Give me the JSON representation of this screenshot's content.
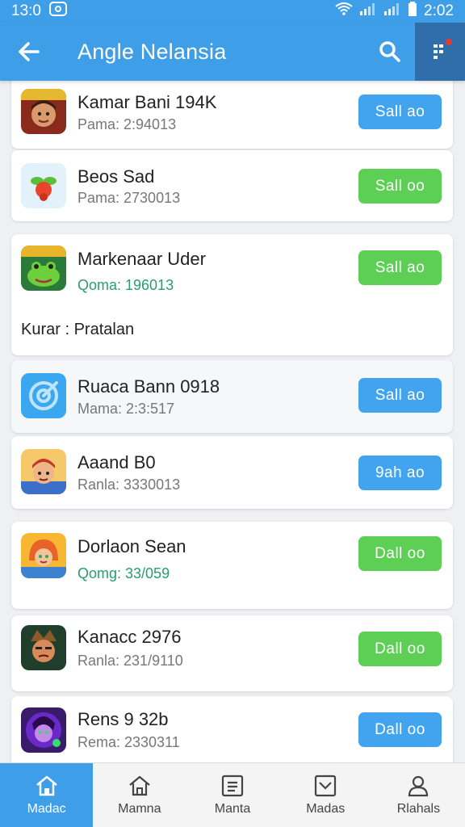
{
  "status": {
    "left_time": "13:0",
    "right_time": "2:02"
  },
  "appbar": {
    "title": "Angle Nelansia"
  },
  "items": [
    {
      "title": "Kamar Bani 194K",
      "subtitle": "Pama: 2:94013",
      "button": "Sall ao",
      "button_color": "blue",
      "icon": "game-icon-warrior"
    },
    {
      "title": "Beos Sad",
      "subtitle": "Pama: 2730013",
      "button": "Sall oo",
      "button_color": "green",
      "icon": "fruit-icon"
    },
    {
      "title": "Markenaar Uder",
      "subtitle": "Qoma: 196013",
      "extra": "Kurar : Pratalan",
      "button": "Sall ao",
      "button_color": "green",
      "icon": "game-icon-frog"
    },
    {
      "title": "Ruaca Bann 0918",
      "subtitle": "Mama: 2:3:517",
      "button": "Sall ao",
      "button_color": "blue",
      "icon": "target-icon"
    },
    {
      "title": "Aaand B0",
      "subtitle": "Ranla: 3330013",
      "button": "9ah ao",
      "button_color": "blue",
      "icon": "game-icon-kid"
    },
    {
      "title": "Dorlaon Sean",
      "subtitle": "Qomg: 33/059",
      "button": "Dall oo",
      "button_color": "green",
      "icon": "game-icon-girl"
    },
    {
      "title": "Kanacc 2976",
      "subtitle": "Ranla: 231/9110",
      "button": "Dall oo",
      "button_color": "green",
      "icon": "game-icon-face"
    },
    {
      "title": "Rens 9 32b",
      "subtitle": "Rema: 2330311",
      "button": "Dall oo",
      "button_color": "blue",
      "icon": "game-icon-hero"
    }
  ],
  "nav": [
    {
      "label": "Madac",
      "icon": "home-icon"
    },
    {
      "label": "Mamna",
      "icon": "home-outline-icon"
    },
    {
      "label": "Manta",
      "icon": "list-icon"
    },
    {
      "label": "Madas",
      "icon": "inbox-icon"
    },
    {
      "label": "Rlahals",
      "icon": "person-icon"
    }
  ],
  "colors": {
    "primary": "#3f9ee8",
    "blue_button": "#42a4ee",
    "green_button": "#5ccf54"
  }
}
